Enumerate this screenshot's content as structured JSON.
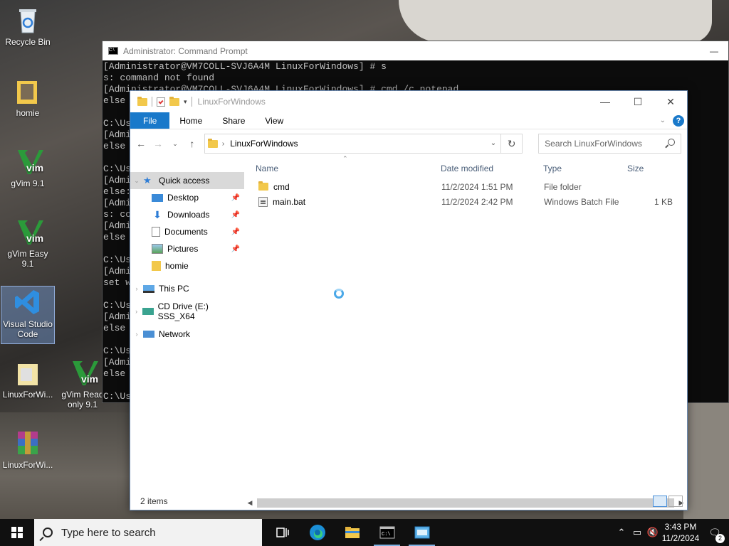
{
  "desktop": {
    "icons": [
      {
        "label": "Recycle Bin"
      },
      {
        "label": "homie"
      },
      {
        "label": "gVim 9.1"
      },
      {
        "label": "gVim Easy 9.1"
      },
      {
        "label": "Visual Studio Code"
      },
      {
        "label": "LinuxForWi..."
      },
      {
        "label": "gVim Read only 9.1"
      },
      {
        "label": "LinuxForWi..."
      }
    ]
  },
  "cmd": {
    "title": "Administrator: Command Prompt",
    "lines": [
      "[Administrator@VM7COLL-SVJ6A4M LinuxForWindows] # s",
      "s: command not found",
      "[Administrator@VM7COLL-SVJ6A4M LinuxForWindows] # cmd /c notepad",
      "else",
      "",
      "C:\\Us",
      "[Admi",
      "else",
      "",
      "C:\\Us",
      "[Admi",
      "else:",
      "[Admi",
      "s: co",
      "[Admi",
      "else",
      "",
      "C:\\Us",
      "[Admi",
      "set w",
      "",
      "C:\\Us",
      "[Admi",
      "else",
      "",
      "C:\\Us",
      "[Admi",
      "else",
      "",
      "C:\\Us"
    ]
  },
  "explorer": {
    "title": "LinuxForWindows",
    "ribbon_tabs": [
      "File",
      "Home",
      "Share",
      "View"
    ],
    "address_path": "LinuxForWindows",
    "search_placeholder": "Search LinuxForWindows",
    "nav": {
      "quick_access": "Quick access",
      "pinned": [
        "Desktop",
        "Downloads",
        "Documents",
        "Pictures",
        "homie"
      ],
      "this_pc": "This PC",
      "cd_drive": "CD Drive (E:) SSS_X64",
      "network": "Network"
    },
    "columns": {
      "name": "Name",
      "date": "Date modified",
      "type": "Type",
      "size": "Size"
    },
    "files": [
      {
        "name": "cmd",
        "date": "11/2/2024 1:51 PM",
        "type": "File folder",
        "size": ""
      },
      {
        "name": "main.bat",
        "date": "11/2/2024 2:42 PM",
        "type": "Windows Batch File",
        "size": "1 KB"
      }
    ],
    "status": "2 items"
  },
  "taskbar": {
    "search_placeholder": "Type here to search",
    "time": "3:43 PM",
    "date": "11/2/2024",
    "notifications": "2"
  },
  "colors": {
    "accent": "#1979ca",
    "folder": "#f2c84b"
  }
}
